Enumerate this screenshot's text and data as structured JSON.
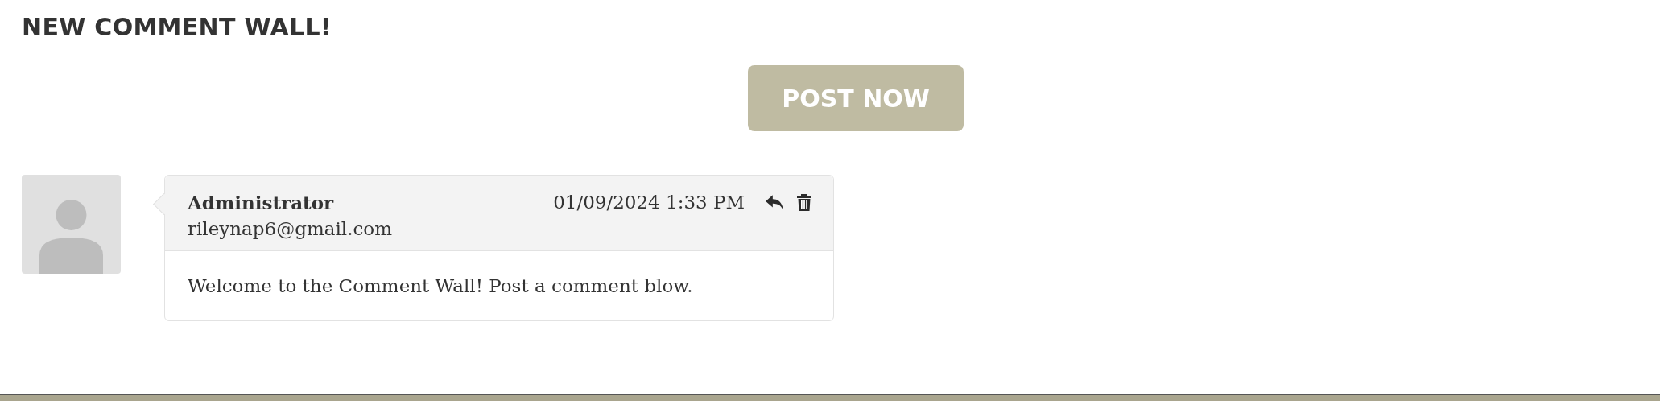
{
  "heading": "NEW COMMENT WALL!",
  "post_button": {
    "label": "POST NOW"
  },
  "comments": [
    {
      "author": "Administrator",
      "email": "rileynap6@gmail.com",
      "timestamp": "01/09/2024 1:33 PM",
      "body": "Welcome to the Comment Wall! Post a comment blow."
    }
  ]
}
